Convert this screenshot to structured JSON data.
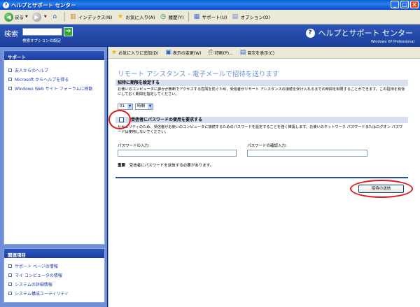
{
  "window": {
    "title": "ヘルプとサポート センター",
    "minimize": "_",
    "maximize": "□",
    "close": "×"
  },
  "toolbar": {
    "back": "戻る",
    "index": "インデックス(N)",
    "favorites": "お気に入り(A)",
    "history": "履歴(Y)",
    "support": "サポート(U)",
    "options": "オプション(O)"
  },
  "header": {
    "search_label": "検索",
    "search_options": "検索オプションの設定",
    "title": "ヘルプとサポート センター",
    "subtitle": "Windows XP Professional"
  },
  "sidebar": {
    "support_title": "サポート",
    "support_items": [
      {
        "label": "友人からのヘルプ"
      },
      {
        "label": "Microsoft からヘルプを得る"
      },
      {
        "label": "Windows Web サイト フォーラムに移動"
      }
    ],
    "related_title": "関連項目",
    "related_items": [
      {
        "label": "サポート ページの情報"
      },
      {
        "label": "マイ コンピュータの情報"
      },
      {
        "label": "システムの詳細情報"
      },
      {
        "label": "システム構成ユーティリティ"
      }
    ]
  },
  "content_toolbar": {
    "add_favorites": "お気に入りに追加(D)",
    "change_view": "表示の変更(W)",
    "print": "印刷(P)...",
    "toc": "目次を表示(C)"
  },
  "page": {
    "title": "リモート アシスタンス - 電子メールで招待を送ります",
    "expiry_section": "招待に期限を設定する",
    "expiry_text": "お使いのコンピュータに誰かが無断でアクセスする危険を防ぐため、受信者がリモート アシスタンスの接続を受け入れるまでの時間を制限することができます。この招待を有効にしておく期間を指定してください。",
    "expiry_value": "01",
    "expiry_unit": "時間",
    "password_checkbox_label": "受信者にパスワードの使用を要求する",
    "password_text": "セキュリティのため、受信者がお使いのコンピュータに接続するためのパスワードを設定することを強く推奨します。お使いのネットワーク パスワードまたはログオン パスワードは使用しないでください。",
    "password_label": "パスワードの入力:",
    "confirm_label": "パスワードの確認入力:",
    "note_label": "重要",
    "note_text": "受信者にパスワードを送信する必要があります。",
    "send_button": "招待の送信"
  },
  "colors": {
    "titlebar": "#0a5fd8",
    "header": "#1d3f9a",
    "sidebar": "#6f8fd8",
    "annotation": "#e01818"
  }
}
